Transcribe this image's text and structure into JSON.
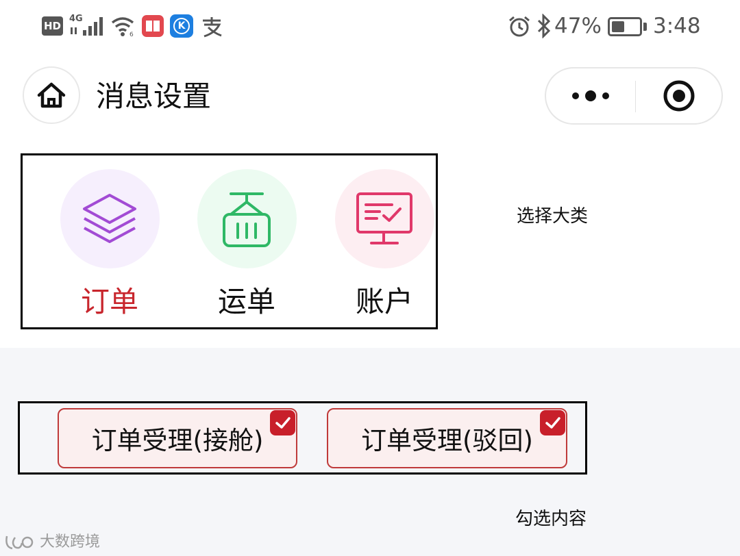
{
  "status_bar": {
    "left_icons": [
      "hd-icon",
      "4g-signal-icon",
      "wifi-icon",
      "book-app-icon",
      "k-app-icon",
      "alipay-icon"
    ],
    "hd": "HD",
    "net": "4G",
    "battery_percent": "47%",
    "battery_level": 0.47,
    "time": "3:48"
  },
  "nav": {
    "title": "消息设置",
    "home_icon": "home-icon",
    "more_icon": "more-dots-icon",
    "close_icon": "close-target-icon"
  },
  "categories": [
    {
      "label": "订单",
      "icon": "layers-icon",
      "circle_color": "#f6effd",
      "icon_color": "#a24bd4",
      "label_color": "#c8262d",
      "selected": true
    },
    {
      "label": "运单",
      "icon": "cargo-crate-icon",
      "circle_color": "#ecfbf1",
      "icon_color": "#2fb866",
      "label_color": "#111111",
      "selected": false
    },
    {
      "label": "账户",
      "icon": "monitor-icon",
      "circle_color": "#fdeef2",
      "icon_color": "#e0386a",
      "label_color": "#111111",
      "selected": false
    }
  ],
  "annotations": {
    "select_category": "选择大类",
    "check_content": "勾选内容"
  },
  "checks": [
    {
      "label": "订单受理(接舱)",
      "checked": true
    },
    {
      "label": "订单受理(驳回)",
      "checked": true
    }
  ],
  "watermark": {
    "text": "大数跨境"
  },
  "colors": {
    "accent": "#c81f2a",
    "section_gray": "#f5f6f9"
  }
}
